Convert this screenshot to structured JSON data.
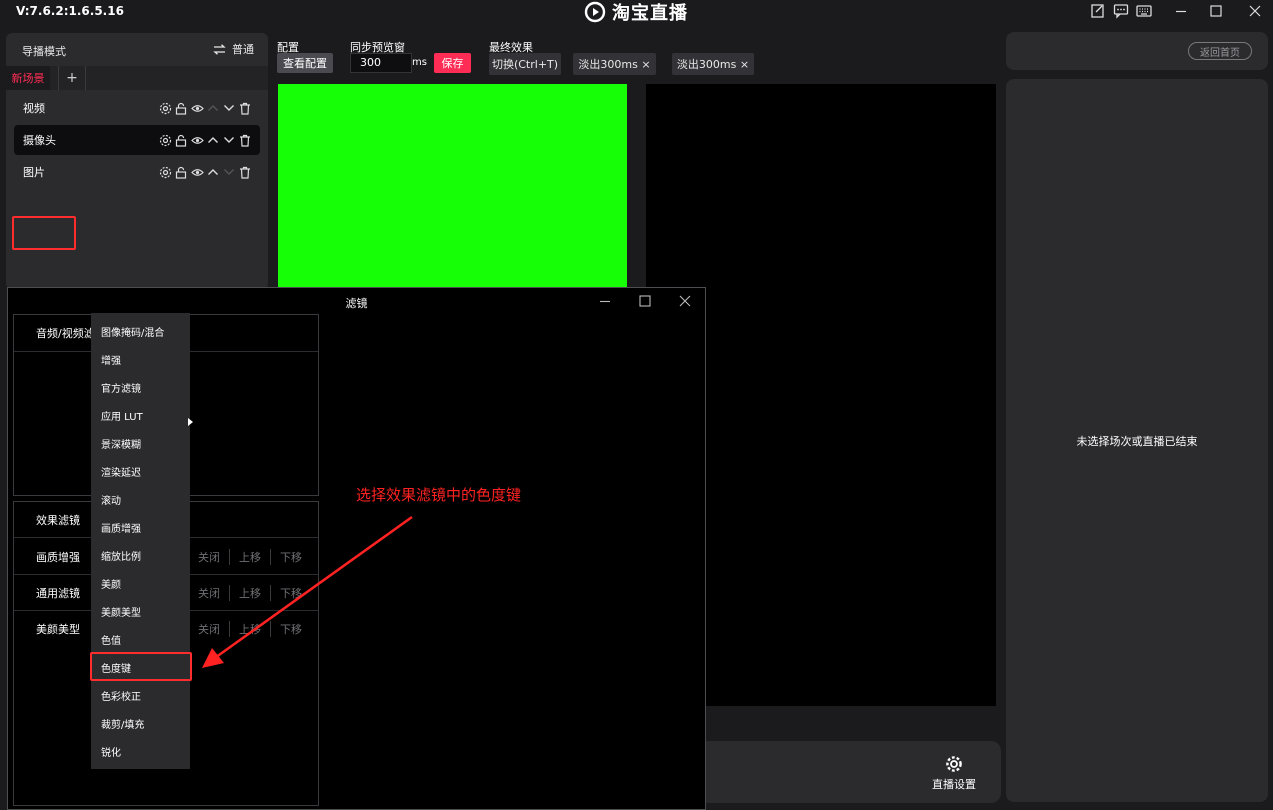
{
  "titlebar": {
    "version": "V:7.6.2:1.6.5.16",
    "app_name": "淘宝直播",
    "icons": [
      "edit-note-icon",
      "chat-icon",
      "keyboard-icon",
      "minimize-icon",
      "maximize-icon",
      "close-icon"
    ]
  },
  "left_panel": {
    "mode_label": "导播模式",
    "mode_switch_label": "普通",
    "scene_tab": "新场景",
    "add_scene": "+",
    "sources": [
      {
        "label": "视频",
        "selected": false
      },
      {
        "label": "摄像头",
        "selected": true
      },
      {
        "label": "图片",
        "selected": false
      }
    ]
  },
  "config": {
    "config_title": "配置",
    "view_config_button": "查看配置",
    "sync_title": "同步预览窗",
    "preview_delay_value": "300",
    "ms_unit": "ms",
    "save_button": "保存",
    "final_effect_title": "最终效果",
    "effect_chips": [
      "切换(Ctrl+T)",
      "淡出300ms ×",
      "淡出300ms ×"
    ]
  },
  "right_panel": {
    "home_button": "返回首页",
    "empty_message": "未选择场次或直播已结束"
  },
  "bottom_bar": {
    "live_settings_label": "直播设置"
  },
  "filter_dialog": {
    "title": "滤镜",
    "audio_video_category": "音频/视频滤",
    "categories": [
      {
        "label": "效果滤镜",
        "ops": []
      },
      {
        "label": "画质增强",
        "ops": [
          "关闭",
          "上移",
          "下移"
        ]
      },
      {
        "label": "通用滤镜",
        "ops": [
          "关闭",
          "上移",
          "下移"
        ]
      },
      {
        "label": "美颜美型",
        "ops": [
          "关闭",
          "上移",
          "下移"
        ]
      }
    ]
  },
  "filter_menu": {
    "items": [
      "图像掩码/混合",
      "增强",
      "官方滤镜",
      "应用 LUT",
      "景深模糊",
      "渲染延迟",
      "滚动",
      "画质增强",
      "缩放比例",
      "美颜",
      "美颜美型",
      "色值",
      "色度键",
      "色彩校正",
      "裁剪/填充",
      "锐化"
    ],
    "highlighted_item": "色度键"
  },
  "annotation": {
    "text": "选择效果滤镜中的色度键",
    "color": "#ff2222"
  },
  "colors": {
    "accent": "#ff2d55",
    "preview_green": "#17ff06",
    "panel_bg": "#2b2b2e",
    "app_bg": "#1b1b1d"
  }
}
